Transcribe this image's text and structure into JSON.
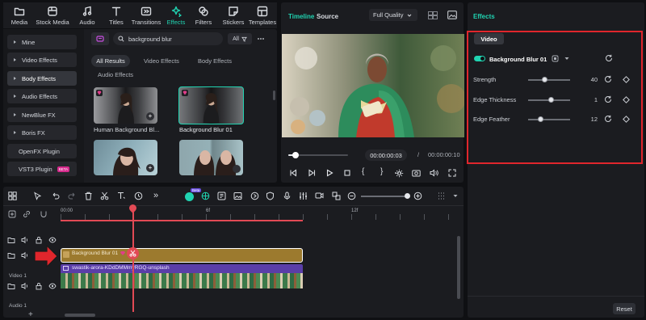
{
  "toolbar": {
    "items": [
      {
        "label": "Media",
        "icon": "folder-icon"
      },
      {
        "label": "Stock Media",
        "icon": "stock-media-icon"
      },
      {
        "label": "Audio",
        "icon": "music-note-icon"
      },
      {
        "label": "Titles",
        "icon": "text-icon"
      },
      {
        "label": "Transitions",
        "icon": "transitions-icon"
      },
      {
        "label": "Effects",
        "icon": "effects-icon",
        "active": true
      },
      {
        "label": "Filters",
        "icon": "filters-icon"
      },
      {
        "label": "Stickers",
        "icon": "stickers-icon"
      },
      {
        "label": "Templates",
        "icon": "templates-icon"
      }
    ]
  },
  "categories": [
    {
      "label": "Mine"
    },
    {
      "label": "Video Effects"
    },
    {
      "label": "Body Effects"
    },
    {
      "label": "Audio Effects"
    },
    {
      "label": "NewBlue FX"
    },
    {
      "label": "Boris FX"
    },
    {
      "label": "OpenFX Plugin"
    },
    {
      "label": "VST3 Plugin",
      "badge": "BETA"
    }
  ],
  "search": {
    "value": "background blur",
    "filter": "All"
  },
  "result_tabs": [
    "All Results",
    "Video Effects",
    "Body Effects",
    "Audio Effects"
  ],
  "results": [
    {
      "caption": "Human Background Bl..."
    },
    {
      "caption": "Background Blur 01"
    },
    {
      "caption": ""
    },
    {
      "caption": ""
    }
  ],
  "player": {
    "tab_timeline": "Timeline",
    "tab_source": "Source",
    "quality": "Full Quality",
    "current_time": "00:00:00:03",
    "separator": "/",
    "total_time": "00:00:00:10",
    "progress": 0.12
  },
  "effects_panel": {
    "title": "Effects",
    "tab": "Video",
    "effect_name": "Background Blur 01",
    "params": [
      {
        "label": "Strength",
        "value": "40",
        "level": 0.4
      },
      {
        "label": "Edge Thickness",
        "value": "1",
        "level": 0.55
      },
      {
        "label": "Edge Feather",
        "value": "12",
        "level": 0.3
      }
    ],
    "reset_label": "Reset"
  },
  "timeline": {
    "ruler": [
      "00:00",
      "6f",
      "12f"
    ],
    "effect_clip": "Background Blur 01",
    "video_clip": "swastik-arora-KDdDMMmyRGQ-unsplash",
    "video_track": "Video 1",
    "audio_track": "Audio 1",
    "ai_badge": "Beta"
  },
  "colors": {
    "accent": "#20d3b1",
    "highlight_border": "#e0262c",
    "effect_clip": "#9c7a2e",
    "video_header": "#5a3ea8",
    "playhead": "#e24a55"
  }
}
